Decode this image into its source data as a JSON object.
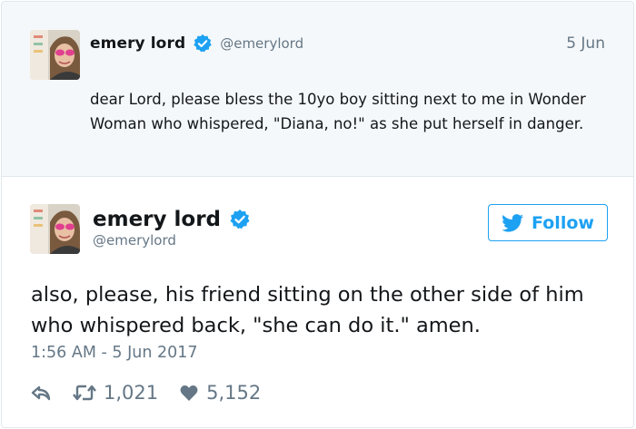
{
  "parent_tweet": {
    "name": "emery lord",
    "handle": "@emerylord",
    "date": "5 Jun",
    "text": "dear Lord, please bless the 10yo boy sitting next to me in Wonder Woman who whispered, \"Diana, no!\" as she put herself in danger."
  },
  "main_tweet": {
    "name": "emery lord",
    "handle": "@emerylord",
    "follow_label": "Follow",
    "text": "also, please, his friend sitting on the other side of him who whispered back, \"she can do it.\" amen.",
    "timestamp": "1:56 AM - 5 Jun 2017",
    "retweets": "1,021",
    "likes": "5,152"
  },
  "icons": [
    "verified-icon",
    "twitter-bird-icon",
    "reply-icon",
    "retweet-icon",
    "heart-icon"
  ],
  "colors": {
    "accent": "#1da1f2",
    "muted": "#657786",
    "parent_background": "#f5f8fa",
    "text": "#14171a"
  }
}
